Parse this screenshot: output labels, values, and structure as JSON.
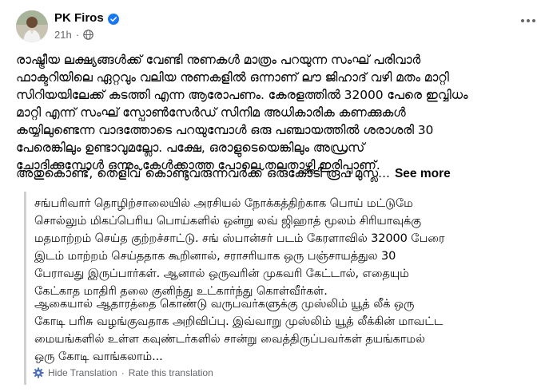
{
  "post": {
    "author_name": "PK Firos",
    "time": "21h",
    "separator": "·",
    "body_paragraph1": "രാഷ്ട്രീയ ലക്ഷ്യങ്ങൾക്ക് വേണ്ടി നുണകൾ മാത്രം പറയുന്ന സംഘ് പരിവാർ\nഫാക്ടറിയിലെ ഏറ്റവും വലിയ നുണകളിൽ ഒന്നാണ് ലൗ ജിഹാദ് വഴി മതം മാറ്റി\nസിറിയയിലേക്ക് കടത്തി എന്ന ആരോപണം. കേരളത്തിൽ 32000 പേരെ ഇവ്വിധം\nമാറ്റി എന്ന് സംഘ് സ്പോൺസേർഡ് സിനിമ അധികാരിക കണക്കുകൾ\nകയ്യിലുണ്ടെന്ന വാദത്തോടെ പറയുമ്പോൾ ഒരു പഞ്ചായത്തിൽ ശരാശരി 30\nപേരെങ്കിലും ഉണ്ടാവുമല്ലോ. പക്ഷേ, ഒരാളുടെയെങ്കിലും അഡ്രസ്\nചോദിക്കുമ്പോൾ ഒന്നും കേൾക്കാത്ത പോലെ തലതാഴ്ത്തി ഇരിപ്പാണ്.",
    "body_paragraph2": "അതുകൊണ്ട്, തെളിവ് കൊണ്ടുവരുന്നവർക്ക് ഒരുകോടി രൂപ മുസ്ല...",
    "see_more_label": "See more"
  },
  "translation": {
    "paragraph1": "சங்பரிவார் தொழிற்சாலையில் அரசியல் நோக்கத்திற்காக பொய் மட்டுமே\nசொல்லும் மிகப்பெரிய பொய்களில் ஒன்று லவ் ஜிஹாத் மூலம் சிரியாவுக்கு\nமதமாற்றம் செய்த குற்றச்சாட்டு. சங் ஸ்பான்சர் படம் கேரளாவில் 32000 பேரை\nஇடம் மாற்றம் செய்ததாக கூறினால், சராசரியாக ஒரு பஞ்சாயத்துல 30\nபேராவது இருப்பார்கள். ஆனால் ஒருவரின் முகவரி கேட்டால், எதையும்\nகேட்காத மாதிரி தலை குனிந்து உட்கார்ந்து கொள்வீர்கள்.",
    "paragraph2": "ஆகையால் ஆதாரத்தை கொண்டு வருபவர்களுக்கு முஸ்லிம் யூத் லீக் ஒரு\nகோடி பரிசு வழங்குவதாக அறிவிப்பு. இவ்வாறு முஸ்லிம் யூத் லீக்கின் மாவட்ட\nமையங்களில் உள்ள கவுண்டர்களில் சான்று வைத்திருப்பவர்கள் தயங்காமல்\nஒரு கோடி வாங்கலாம்...",
    "hide_label": "Hide Translation",
    "separator": "·",
    "rate_label": "Rate this translation"
  },
  "icons": {
    "verified": "verified-badge-icon",
    "privacy": "globe-icon",
    "more": "more-options-icon",
    "settings": "gear-icon"
  },
  "colors": {
    "verified_blue": "#1877f2",
    "secondary_text": "#65676b",
    "quote_border": "#ced0d4"
  }
}
